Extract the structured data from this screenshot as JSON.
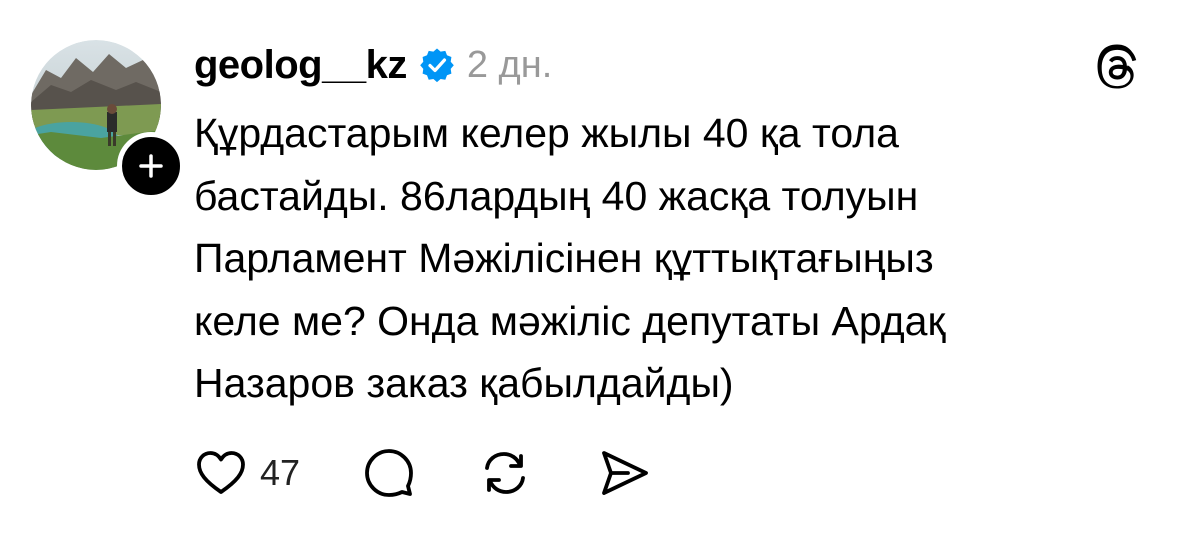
{
  "post": {
    "username": "geolog__kz",
    "verified": true,
    "timestamp": "2 дн.",
    "text": "Құрдастарым келер жылы 40 қа тола\nбастайды. 86лардың 40 жасқа толуын\nПарламент Мәжілісінен құттықтағыңыз\nкеле ме? Онда мәжіліс депутаты Ардақ\nНазаров заказ қабылдайды)",
    "likes_count": "47"
  },
  "icons": {
    "avatar": "profile-photo-mountain-lake",
    "follow": "plus-icon",
    "verified": "verified-badge-icon",
    "app_logo": "threads-logo-icon",
    "like": "heart-icon",
    "comment": "comment-bubble-icon",
    "repost": "repost-icon",
    "share": "send-icon"
  },
  "colors": {
    "text": "#000000",
    "muted": "#999999",
    "verified_blue": "#0095F6",
    "background": "#FFFFFF"
  }
}
